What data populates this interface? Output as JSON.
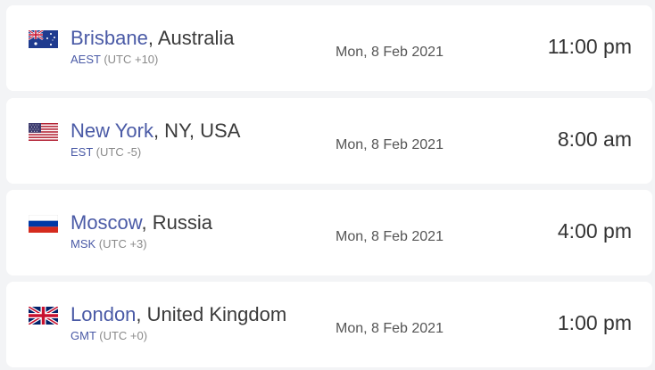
{
  "clocks": [
    {
      "flag_icon": "australia-flag-icon",
      "city": "Brisbane",
      "region": ", Australia",
      "tz_abbr": "AEST",
      "tz_offset": " (UTC +10)",
      "date": "Mon, 8 Feb 2021",
      "time": "11:00 pm"
    },
    {
      "flag_icon": "usa-flag-icon",
      "city": "New York",
      "region": ", NY, USA",
      "tz_abbr": "EST",
      "tz_offset": " (UTC -5)",
      "date": "Mon, 8 Feb 2021",
      "time": "8:00 am"
    },
    {
      "flag_icon": "russia-flag-icon",
      "city": "Moscow",
      "region": ", Russia",
      "tz_abbr": "MSK",
      "tz_offset": " (UTC +3)",
      "date": "Mon, 8 Feb 2021",
      "time": "4:00 pm"
    },
    {
      "flag_icon": "uk-flag-icon",
      "city": "London",
      "region": ", United Kingdom",
      "tz_abbr": "GMT",
      "tz_offset": " (UTC +0)",
      "date": "Mon, 8 Feb 2021",
      "time": "1:00 pm"
    }
  ]
}
